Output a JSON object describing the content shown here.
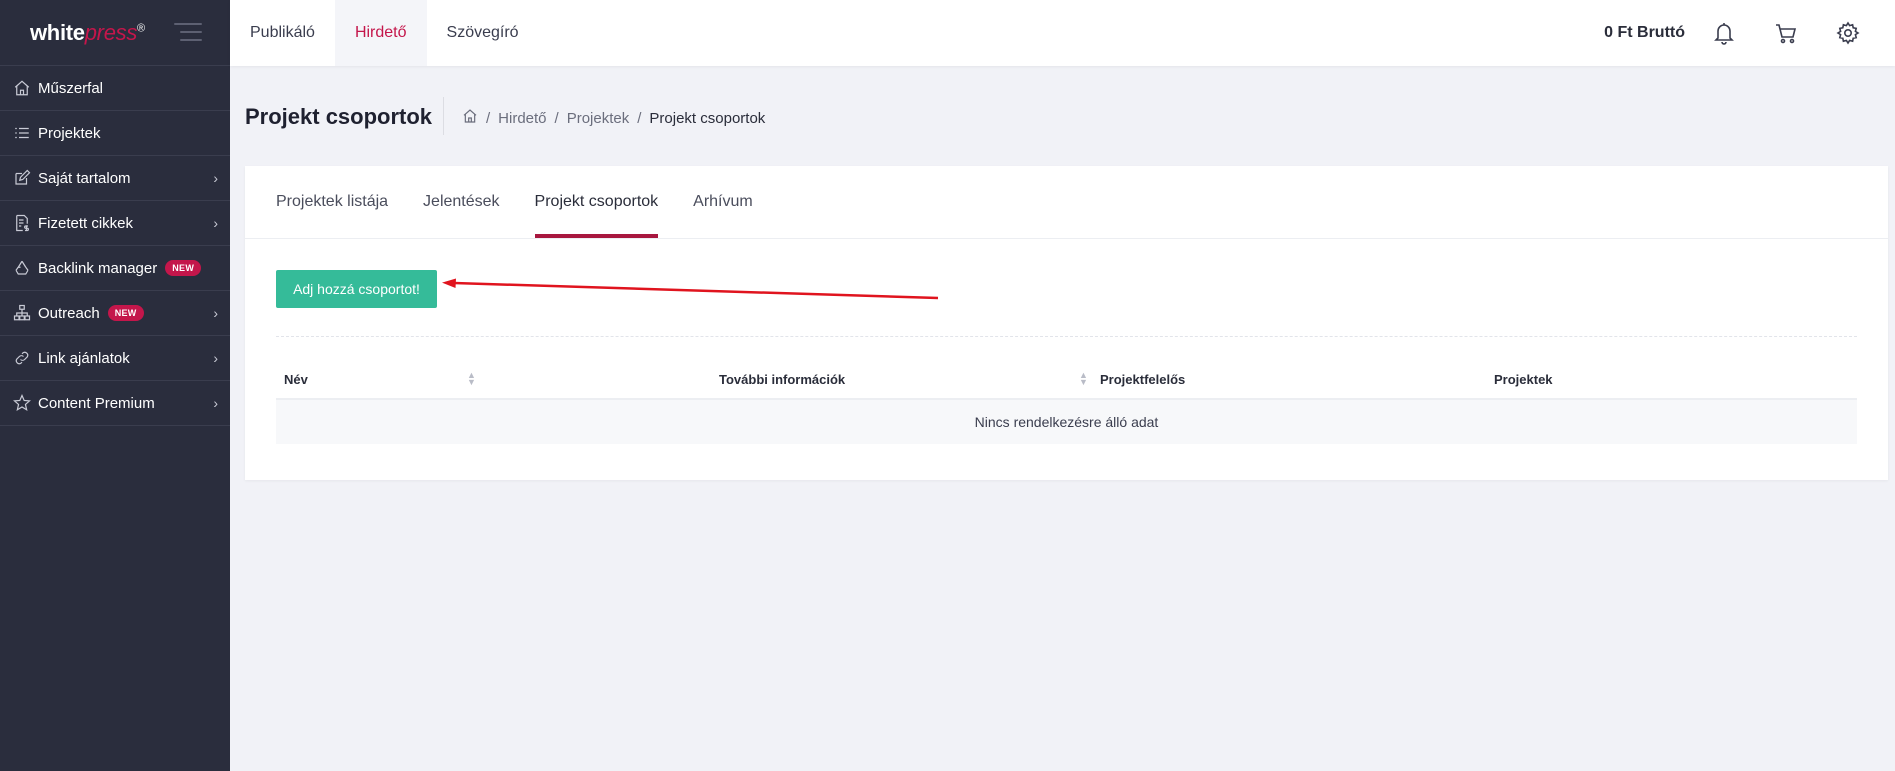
{
  "brand": {
    "logo_main": "white",
    "logo_accent": "press",
    "logo_reg": "®"
  },
  "sidebar": {
    "items": [
      {
        "label": "Műszerfal",
        "icon": "home-icon",
        "chevron": false,
        "badge": ""
      },
      {
        "label": "Projektek",
        "icon": "list-icon",
        "chevron": false,
        "badge": ""
      },
      {
        "label": "Saját tartalom",
        "icon": "edit-icon",
        "chevron": true,
        "badge": ""
      },
      {
        "label": "Fizetett cikkek",
        "icon": "paid-document-icon",
        "chevron": true,
        "badge": ""
      },
      {
        "label": "Backlink manager",
        "icon": "recycle-icon",
        "chevron": false,
        "badge": "NEW"
      },
      {
        "label": "Outreach",
        "icon": "sitemap-icon",
        "chevron": true,
        "badge": "NEW"
      },
      {
        "label": "Link ajánlatok",
        "icon": "link-icon",
        "chevron": true,
        "badge": ""
      },
      {
        "label": "Content Premium",
        "icon": "star-icon",
        "chevron": true,
        "badge": ""
      }
    ]
  },
  "topnav": {
    "items": [
      {
        "label": "Publikáló",
        "active": false
      },
      {
        "label": "Hirdető",
        "active": true
      },
      {
        "label": "Szövegíró",
        "active": false
      }
    ],
    "balance": "0 Ft Bruttó"
  },
  "page": {
    "title": "Projekt csoportok",
    "breadcrumb": [
      "Hirdető",
      "Projektek",
      "Projekt csoportok"
    ]
  },
  "tabs": [
    {
      "label": "Projektek listája",
      "active": false
    },
    {
      "label": "Jelentések",
      "active": false
    },
    {
      "label": "Projekt csoportok",
      "active": true
    },
    {
      "label": "Arhívum",
      "active": false
    }
  ],
  "add_button": "Adj hozzá csoportot!",
  "table": {
    "columns": [
      "Név",
      "További információk",
      "Projektfelelős",
      "Projektek"
    ],
    "empty_text": "Nincs rendelkezésre álló adat"
  },
  "colors": {
    "accent": "#c4164b",
    "button": "#35bb99",
    "sidebar_bg": "#2a2d3d",
    "arrow": "#e0141e"
  }
}
